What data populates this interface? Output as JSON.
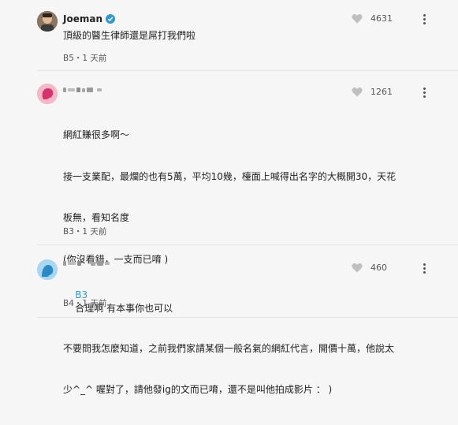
{
  "comments": [
    {
      "author": "Joeman",
      "verified": true,
      "likes": "4631",
      "text": "頂級的醫生律師還是屌打我們啦",
      "floor": "B5",
      "time": "1 天前"
    },
    {
      "author": "",
      "likes": "1261",
      "lines": [
        "網紅賺很多啊～",
        "接一支業配，最爛的也有5萬，平均10幾，檯面上喊得出名字的大概開30，天花",
        "板無，看知名度",
        "(你沒看錯，一支而已唷 )",
        "",
        "不要問我怎麼知道，之前我們家請某個一般名氣的網紅代言，開價十萬，他說太",
        "少^_^ 喔對了，請他發ig的文而已唷，還不是叫他拍成影片 ： )"
      ],
      "floor": "B3",
      "time": "1 天前"
    },
    {
      "author": "",
      "likes": "460",
      "mention": "B3",
      "text": "合理啊 有本事你也可以",
      "floor": "B4",
      "time": "1 天前"
    }
  ],
  "colors": {
    "background": "#f6f6f6",
    "mention": "#3397cf",
    "verified": "#3397cf",
    "heart": "#bfbfbf"
  },
  "icons": [
    "heart-icon",
    "more-options-icon",
    "verified-icon",
    "avatar"
  ]
}
